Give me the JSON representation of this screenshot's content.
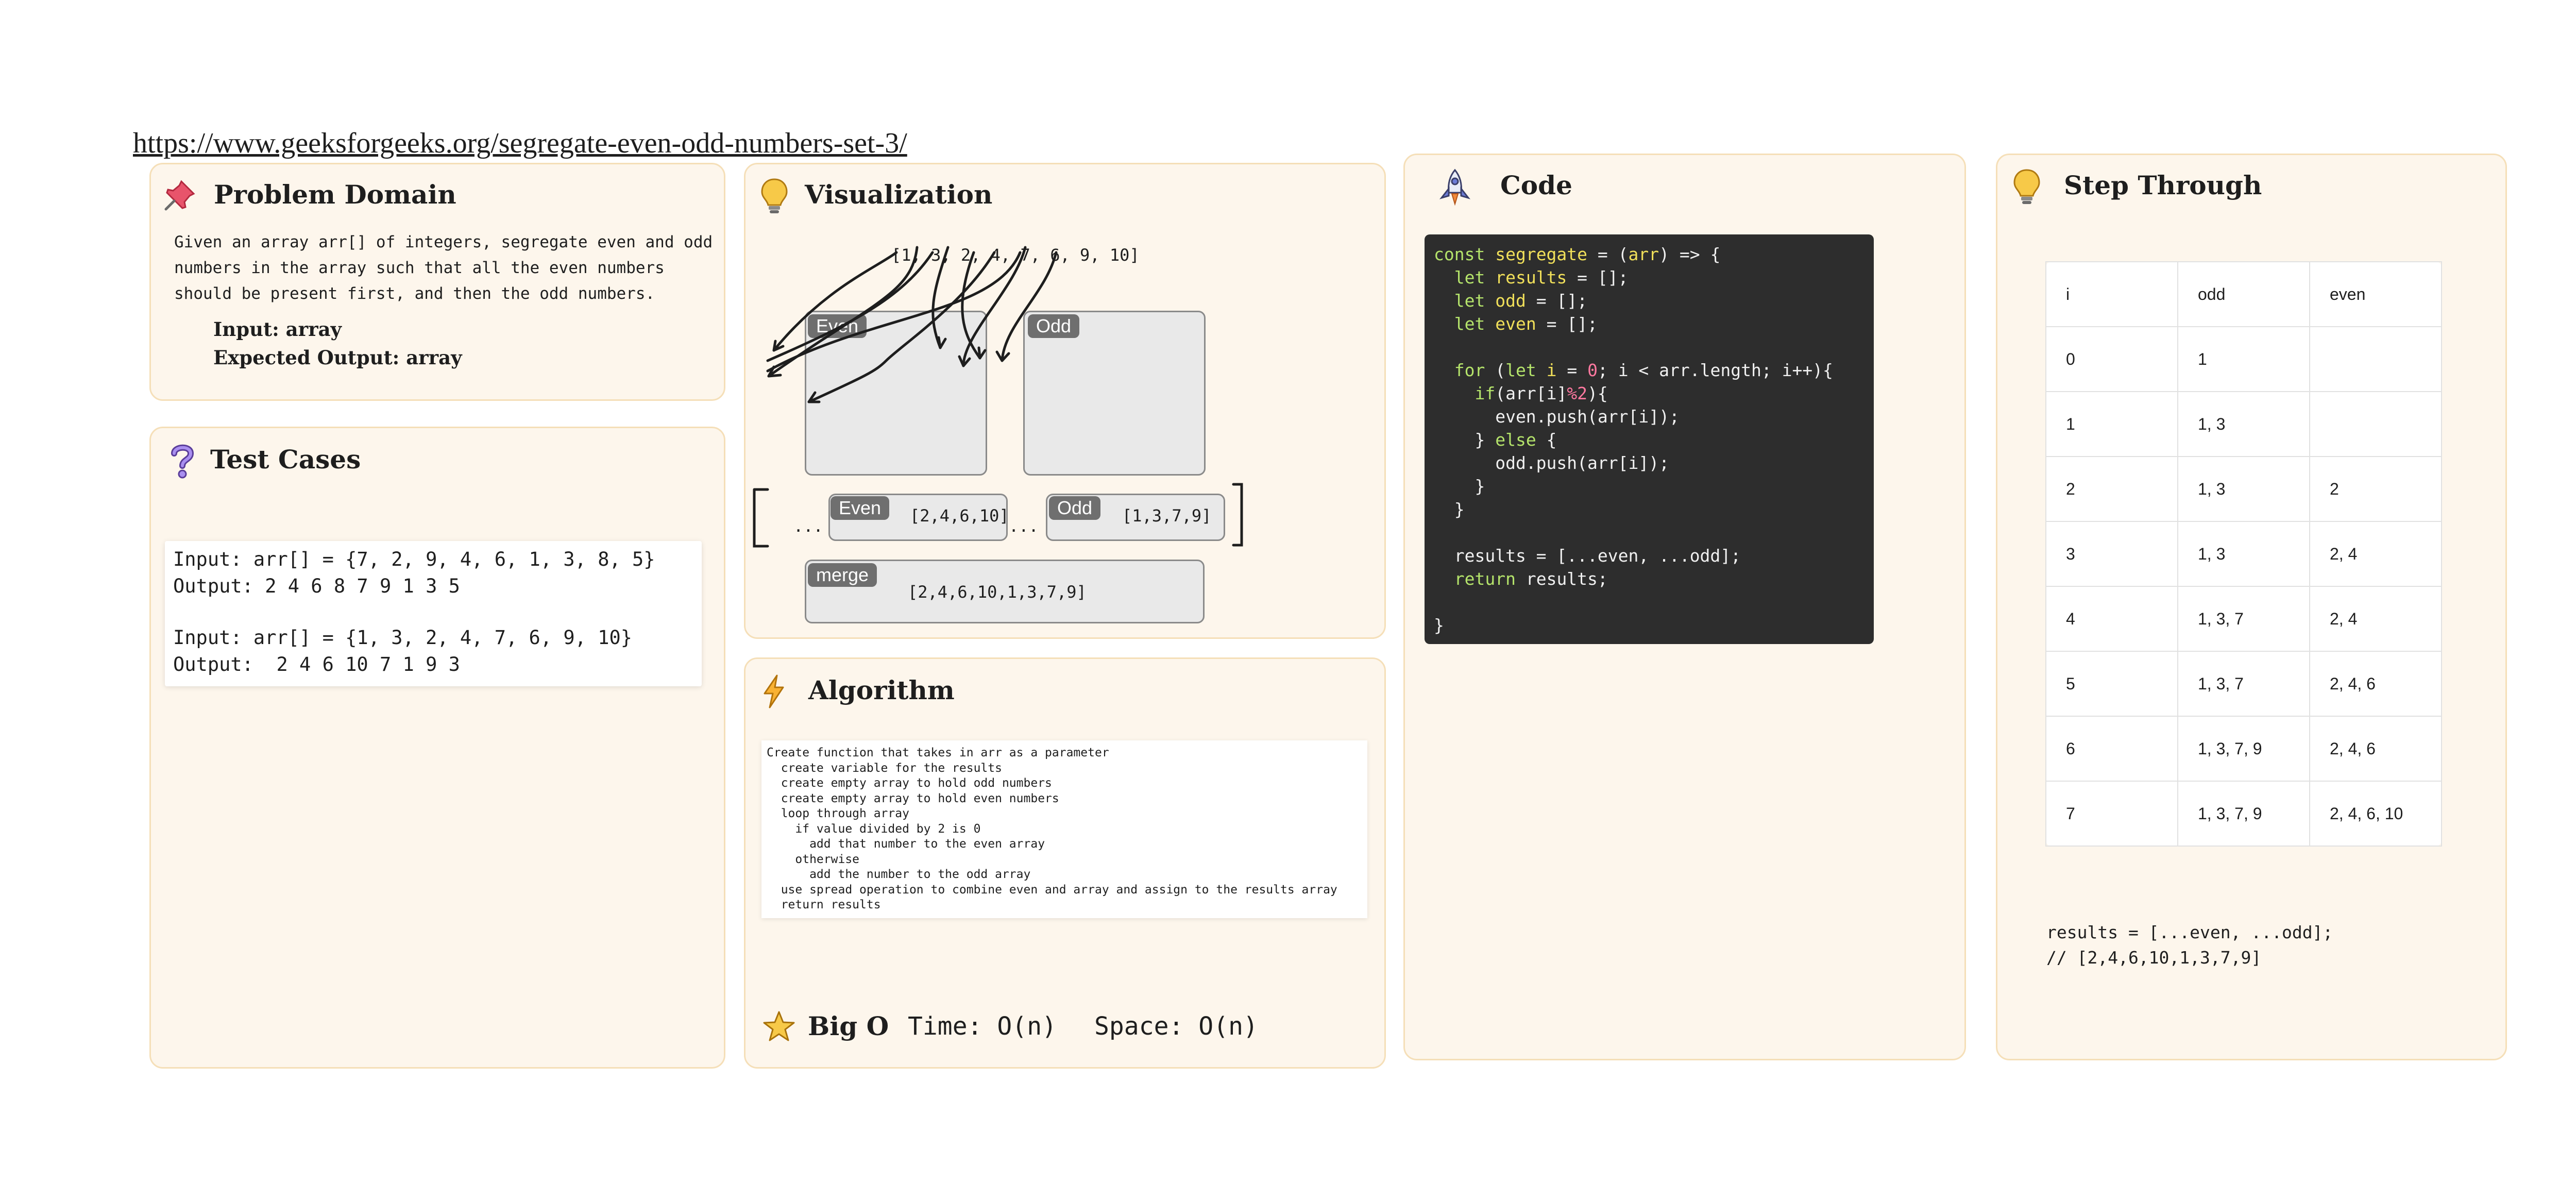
{
  "url": "https://www.geeksforgeeks.org/segregate-even-odd-numbers-set-3/",
  "problem_domain": {
    "title": "Problem Domain",
    "description": "Given an array arr[] of integers, segregate even and odd numbers in the array such that all the even numbers should be present first, and then the odd numbers.",
    "input": "Input: array",
    "expected_output": "Expected Output: array"
  },
  "test_cases": {
    "title": "Test Cases",
    "lines": [
      "Input: arr[] = {7, 2, 9, 4, 6, 1, 3, 8, 5}",
      "Output: 2 4 6 8 7 9 1 3 5",
      "Input: arr[] = {1, 3, 2, 4, 7, 6, 9, 10}",
      "Output:  2 4 6 10 7 1 9 3"
    ]
  },
  "visualization": {
    "title": "Visualization",
    "input_array": "[1, 3, 2, 4, 7, 6, 9, 10]",
    "even_label": "Even",
    "odd_label": "Odd",
    "even_values": "[2,4,6,10]",
    "odd_values": "[1,3,7,9]",
    "spread_left": "...",
    "spread_mid": "...",
    "merge_label": "merge",
    "merge_values": "[2,4,6,10,1,3,7,9]"
  },
  "algorithm": {
    "title": "Algorithm",
    "lines": [
      "Create function that takes in arr as a parameter",
      "  create variable for the results",
      "  create empty array to hold odd numbers",
      "  create empty array to hold even numbers",
      "  loop through array",
      "    if value divided by 2 is 0",
      "      add that number to the even array",
      "    otherwise",
      "      add the number to the odd array",
      "  use spread operation to combine even and array and assign to the results array",
      "  return results"
    ]
  },
  "big_o": {
    "title": "Big O",
    "time": "Time: O(n)",
    "space": "Space: O(n)"
  },
  "code": {
    "title": "Code"
  },
  "step_through": {
    "title": "Step Through",
    "headers": [
      "i",
      "odd",
      "even"
    ],
    "rows": [
      [
        "0",
        "1",
        ""
      ],
      [
        "1",
        "1, 3",
        ""
      ],
      [
        "2",
        "1, 3",
        "2"
      ],
      [
        "3",
        "1, 3",
        "2, 4"
      ],
      [
        "4",
        "1, 3, 7",
        "2, 4"
      ],
      [
        "5",
        "1, 3, 7",
        "2, 4, 6"
      ],
      [
        "6",
        "1, 3, 7, 9",
        "2, 4, 6"
      ],
      [
        "7",
        "1, 3, 7, 9",
        "2, 4, 6, 10"
      ]
    ],
    "result_line_1": "results = [...even, ...odd];",
    "result_line_2": "// [2,4,6,10,1,3,7,9]"
  },
  "colors": {
    "panel_bg": "#fdf6ec",
    "panel_border": "#f5dfb8",
    "code_bg": "#2d2d2d",
    "tag_bg": "#6f6f6f"
  },
  "icons": [
    "pushpin-icon",
    "question-mark-icon",
    "lightbulb-icon",
    "lightning-icon",
    "star-icon",
    "rocket-icon"
  ]
}
